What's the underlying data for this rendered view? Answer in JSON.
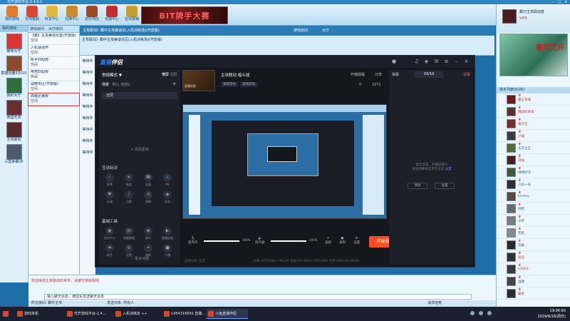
{
  "window": {
    "title": "光芒游戏平台-2.4.0.1"
  },
  "toolbar": {
    "items": [
      {
        "label": "我的游戏",
        "color": "#e07a2e"
      },
      {
        "label": "在线客服",
        "color": "#d6472f"
      },
      {
        "label": "好友中心",
        "color": "#e2b73a"
      },
      {
        "label": "兑换中心",
        "color": "#c9892d"
      },
      {
        "label": "加分商店",
        "color": "#9b4a2a"
      },
      {
        "label": "充值中心",
        "color": "#c0302b"
      },
      {
        "label": "在线报销",
        "color": "#c89c2f"
      }
    ],
    "banner": "BIT牌手大赛"
  },
  "left_games": {
    "header": "我的游戏",
    "items": [
      {
        "name": "聚英大厅",
        "color": "#d33"
      },
      {
        "name": "群雄逐鹿10v10",
        "color": "#8a4d2b"
      },
      {
        "name": "我的大厅",
        "color": "#2f6e3d"
      },
      {
        "name": "帝国无双",
        "color": "#6b2f2f"
      },
      {
        "name": "主攻联动",
        "color": "#5a2a2a"
      },
      {
        "name": "三国争霸v6",
        "color": "#4c5a6b"
      }
    ]
  },
  "rooms": {
    "tabs": [
      "游戏房间",
      "大厅房间"
    ],
    "items": [
      {
        "name": "【霸】主攻兼谈论室(开放版)",
        "status": "空闲"
      },
      {
        "name": "入机谈战界",
        "status": "空闲"
      },
      {
        "name": "新手匹配房",
        "status": "热闹"
      },
      {
        "name": "电竞匹配房",
        "status": "热闹"
      },
      {
        "name": "战略专区(开放版)",
        "status": "空闲"
      },
      {
        "name": "高级比赛房",
        "status": "空闲"
      }
    ]
  },
  "main_header": {
    "left": "主攻联动》霸中主攻兼谈论(入机训练场)(开放版)",
    "tab1": "游戏房间",
    "tab2": "大厅"
  },
  "room_title": "主攻联动》霸中主攻兼谈论区(入机训练场)(开放版)",
  "seats": [
    "等待中",
    "等待中",
    "等待中",
    "等待中",
    "等待中",
    "等待中",
    "等待中",
    "等待中",
    "等待中"
  ],
  "stream_app": {
    "logo_a": "直播",
    "logo_b": "伴侣",
    "mode": "常规模式 ▼",
    "mode_tabs": [
      "横屏",
      "竖屏"
    ],
    "scene_tabs": [
      "场景",
      "默认",
      "场景2"
    ],
    "scene_item": "全屏",
    "add_source": "+ 添加素材",
    "section_interact": "互动玩法",
    "interact_items": [
      "投票",
      "抽奖",
      "连麦",
      "PK",
      "礼物",
      "点歌",
      "弹幕",
      "红包"
    ],
    "section_tools": "基础工具",
    "tool_items": [
      "任务中心",
      "直播数据",
      "观众",
      "直播回放",
      "助手",
      "设置",
      "美颜",
      "下播"
    ],
    "more": "··· 更多功能",
    "stream_title": "主攻联动 暗斗战",
    "tags": [
      "策略游戏",
      "策略游戏"
    ],
    "thumb_label": "直播封面",
    "actions": [
      "开播提醒",
      "分享"
    ],
    "stats": [
      "0",
      "2271"
    ],
    "controls": {
      "mic": "麦克风",
      "speaker": "扬声器",
      "beauty": "美颜",
      "record": "录制",
      "settings": "设置",
      "mic_pct": "100%",
      "spk_pct": "100%",
      "mic_level": 1.0,
      "spk_level": 1.0
    },
    "golive": "开始直播 ▸",
    "status_left": "当前码率: 正常 ",
    "status_right": "码率:4671kbps   FPS:30   丢帧:0(0.00%)   CPU:18%   内存:44%   00:00:00",
    "right_panel": {
      "header": "弹幕",
      "count": "10/10",
      "option": "设置",
      "message_a": "暂无消息，开播后观众",
      "message_b": "发送弹幕将显示在这里",
      "link": "设置",
      "btn1": "清屏",
      "btn2": "设置"
    }
  },
  "chat": {
    "line1": "欢迎来到主攻联动的世界，请遵守游戏规则",
    "input": "输入聊天信息，按回车发送聊天信息",
    "bar_left": "所在房间: 霸中主攻",
    "bar_mid": "发送对象: 所有人",
    "bar_right": "请求连麦"
  },
  "right_panel": {
    "username": "霸刃主攻联动者",
    "level": "VIP5",
    "ad_text": "春风又开",
    "list_header": "高手列表(6/26)",
    "players": [
      {
        "name": "霸王攻城",
        "red": true,
        "color": "#6b1d1d"
      },
      {
        "name": "魏国的某某",
        "red": true,
        "color": "#5e3030"
      },
      {
        "name": "蜀汉王",
        "red": true,
        "color": "#7a2d2d"
      },
      {
        "name": "小强",
        "red": true,
        "color": "#3a3a3a"
      },
      {
        "name": "东方之王",
        "red": false,
        "color": "#556b2f"
      },
      {
        "name": "剑仙",
        "red": true,
        "color": "#4b2020"
      },
      {
        "name": "绿林好汉",
        "red": false,
        "color": "#3c5a3c"
      },
      {
        "name": "小兵一号",
        "red": false,
        "color": "#2f2f2f"
      },
      {
        "name": "kinsley",
        "red": false,
        "color": "#5a4a3a"
      },
      {
        "name": "孙权",
        "red": false,
        "color": "#6a6a6a"
      },
      {
        "name": "小乔",
        "red": false,
        "color": "#7b7b7b"
      },
      {
        "name": "无名",
        "red": false,
        "color": "#8a8a8a"
      },
      {
        "name": "刘备",
        "red": false,
        "color": "#2a2a2a"
      },
      {
        "name": "赵云",
        "red": true,
        "color": "#333333"
      },
      {
        "name": "LOSER",
        "red": true,
        "color": "#3a3a3a"
      },
      {
        "name": "战歌",
        "red": false,
        "color": "#444444"
      },
      {
        "name": "霸主",
        "red": true,
        "color": "#2d2d2d"
      }
    ]
  },
  "taskbar": {
    "items": [
      {
        "label": "游戏单机"
      },
      {
        "label": "光芒游戏平台-2.4..."
      },
      {
        "label": "入机训练房 ++"
      },
      {
        "label": "1454316691·直播..."
      },
      {
        "label": "斗鱼直播伴侣"
      }
    ],
    "time": "19:06:50",
    "date": "2024/6/16(周日)"
  }
}
